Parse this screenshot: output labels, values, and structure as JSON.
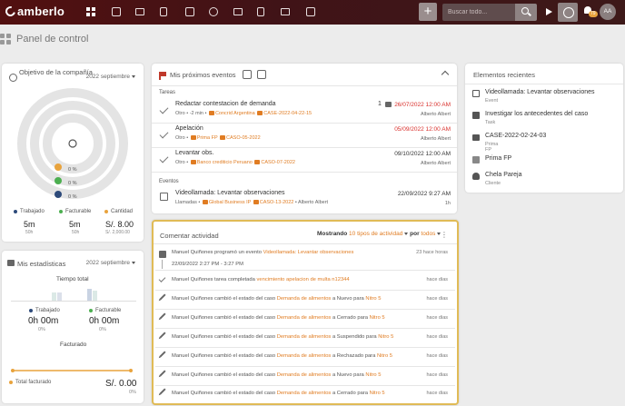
{
  "app": {
    "brand": "amberlo",
    "search_placeholder": "Buscar todo...",
    "notif_count": "79",
    "avatar_initials": "AA",
    "accent": "#e07c22",
    "brand_bg": "#3d1519"
  },
  "page": {
    "title": "Panel de control"
  },
  "objective": {
    "title": "Objetivo de la compañía",
    "period": "2022 septiembre",
    "rings": [
      {
        "color": "#e8a33d",
        "pct": "0 %"
      },
      {
        "color": "#4caf50",
        "pct": "0 %"
      },
      {
        "color": "#2d4a7a",
        "pct": "0 %"
      }
    ],
    "metrics": [
      {
        "label": "Trabajado",
        "color": "#2d4a7a",
        "value": "5m",
        "sub": "50h"
      },
      {
        "label": "Facturable",
        "color": "#4caf50",
        "value": "5m",
        "sub": "50h"
      },
      {
        "label": "Cantidad",
        "color": "#e8a33d",
        "value": "S/. 8.00",
        "sub": "S/. 2,000.00"
      }
    ]
  },
  "stats": {
    "title": "Mis estadísticas",
    "period": "2022 septiembre",
    "chart_title": "Tiempo total",
    "trabajado": {
      "label": "Trabajado",
      "value": "0h 00m",
      "pct": "0%"
    },
    "facturable": {
      "label": "Facturable",
      "value": "0h 00m",
      "pct": "0%"
    },
    "facturado_title": "Facturado",
    "total_label": "Total facturado",
    "total_value": "S/. 0.00",
    "total_pct": "0%"
  },
  "events": {
    "title": "Mis próximos eventos",
    "tasks_label": "Tareas",
    "events_label": "Eventos",
    "tasks": [
      {
        "title": "Redactar contestacion de demanda",
        "type": "Otro",
        "duration": "-2 min",
        "client": "Concrid Argentina",
        "case": "CASE-2022-04-22-15",
        "comments": "1",
        "date": "26/07/2022 12:00 AM",
        "date_color": "red",
        "who": "Alberto Albert"
      },
      {
        "title": "Apelación",
        "type": "Otro",
        "duration": "",
        "client": "Prima FP",
        "case": "CASO-05-2022",
        "comments": "",
        "date": "05/09/2022 12:00 AM",
        "date_color": "red",
        "who": "Alberto Albert"
      },
      {
        "title": "Levantar obs.",
        "type": "Otro",
        "duration": "",
        "client": "Banco crediticio Peruano",
        "case": "CASO-07-2022",
        "comments": "",
        "date": "09/10/2022 12:00 AM",
        "date_color": "normal",
        "who": "Alberto Albert"
      }
    ],
    "event": {
      "title": "Videollamada: Levantar observaciones",
      "type": "Llamadas",
      "client": "Global Business IP",
      "case": "CASO-13-2022",
      "who": "Alberto Albert",
      "date": "22/09/2022 9:27 AM",
      "duration": "1h"
    }
  },
  "activity": {
    "title": "Comentar actividad",
    "showing_prefix": "Mostrando",
    "showing_types": "10 tipos de actividad",
    "by_label": "por",
    "by_value": "todos",
    "first": {
      "user": "Manuel Quiñones programó un evento",
      "link": "Videollamada: Levantar observaciones",
      "time": "23 hace horas",
      "range": "22/09/2022 2:27 PM - 3:27 PM"
    },
    "second": {
      "text": "Manuel Quiñones tarea completada",
      "link": "vencimiento apelacion de multa n12344",
      "time": "hace dias"
    },
    "rows": [
      {
        "pre": "Manuel Quiñones cambió el estado del caso",
        "case": "Demanda de alimentos",
        "mid": "a Nuevo para",
        "client": "Nitro 5",
        "time": "hace dias"
      },
      {
        "pre": "Manuel Quiñones cambió el estado del caso",
        "case": "Demanda de alimentos",
        "mid": "a Cerrado para",
        "client": "Nitro 5",
        "time": "hace dias"
      },
      {
        "pre": "Manuel Quiñones cambió el estado del caso",
        "case": "Demanda de alimentos",
        "mid": "a Suspendido para",
        "client": "Nitro 5",
        "time": "hace dias"
      },
      {
        "pre": "Manuel Quiñones cambió el estado del caso",
        "case": "Demanda de alimentos",
        "mid": "a Rechazado para",
        "client": "Nitro 5",
        "time": "hace dias"
      },
      {
        "pre": "Manuel Quiñones cambió el estado del caso",
        "case": "Demanda de alimentos",
        "mid": "a Nuevo para",
        "client": "Nitro 5",
        "time": "hace dias"
      },
      {
        "pre": "Manuel Quiñones cambió el estado del caso",
        "case": "Demanda de alimentos",
        "mid": "a Cerrado para",
        "client": "Nitro 5",
        "time": "hace dias"
      }
    ]
  },
  "recent": {
    "title": "Elementos recientes",
    "items": [
      {
        "title": "Videollamada: Levantar observaciones",
        "sub": "Event",
        "icon": "calendar-icon"
      },
      {
        "title": "Investigar los antecedentes del caso",
        "sub": "Task",
        "icon": "checkbox-icon"
      },
      {
        "title": "CASE-2022-02-24-03",
        "sub": "Prima FP",
        "icon": "briefcase-icon"
      },
      {
        "title": "Prima FP",
        "sub": "",
        "icon": "building-icon"
      },
      {
        "title": "Chela Pareja",
        "sub": "Cliente",
        "icon": "person-icon"
      }
    ]
  }
}
